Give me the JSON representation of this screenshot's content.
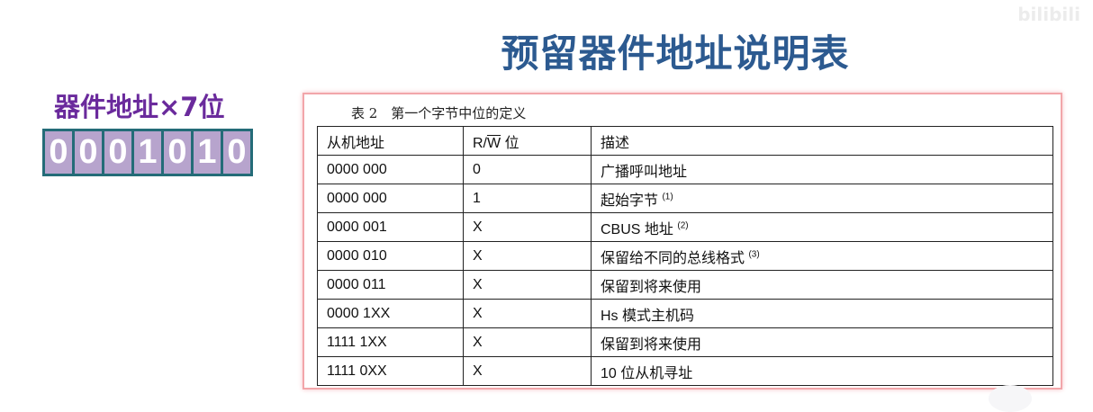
{
  "title": "预留器件地址说明表",
  "watermark": "bilibili",
  "left": {
    "label": "器件地址×7位",
    "bits": [
      "0",
      "0",
      "0",
      "1",
      "0",
      "1",
      "0"
    ],
    "colors": {
      "label": "#6a2a9c",
      "cell": "#b7a4cd",
      "border": "#246c78"
    }
  },
  "table": {
    "caption": "表 2　第一个字节中位的定义",
    "headers": [
      "从机地址",
      "R/",
      "W",
      "位",
      "描述"
    ],
    "rows": [
      {
        "addr": "0000 000",
        "rw": "0",
        "desc": "广播呼叫地址",
        "note": ""
      },
      {
        "addr": "0000 000",
        "rw": "1",
        "desc": "起始字节",
        "note": "(1)"
      },
      {
        "addr": "0000 001",
        "rw": "X",
        "desc": "CBUS 地址",
        "note": "(2)"
      },
      {
        "addr": "0000 010",
        "rw": "X",
        "desc": "保留给不同的总线格式",
        "note": "(3)"
      },
      {
        "addr": "0000 011",
        "rw": "X",
        "desc": "保留到将来使用",
        "note": ""
      },
      {
        "addr": "0000 1XX",
        "rw": "X",
        "desc": "Hs 模式主机码",
        "note": ""
      },
      {
        "addr": "1111 1XX",
        "rw": "X",
        "desc": "保留到将来使用",
        "note": ""
      },
      {
        "addr": "1111 0XX",
        "rw": "X",
        "desc": "10 位从机寻址",
        "note": ""
      }
    ]
  }
}
